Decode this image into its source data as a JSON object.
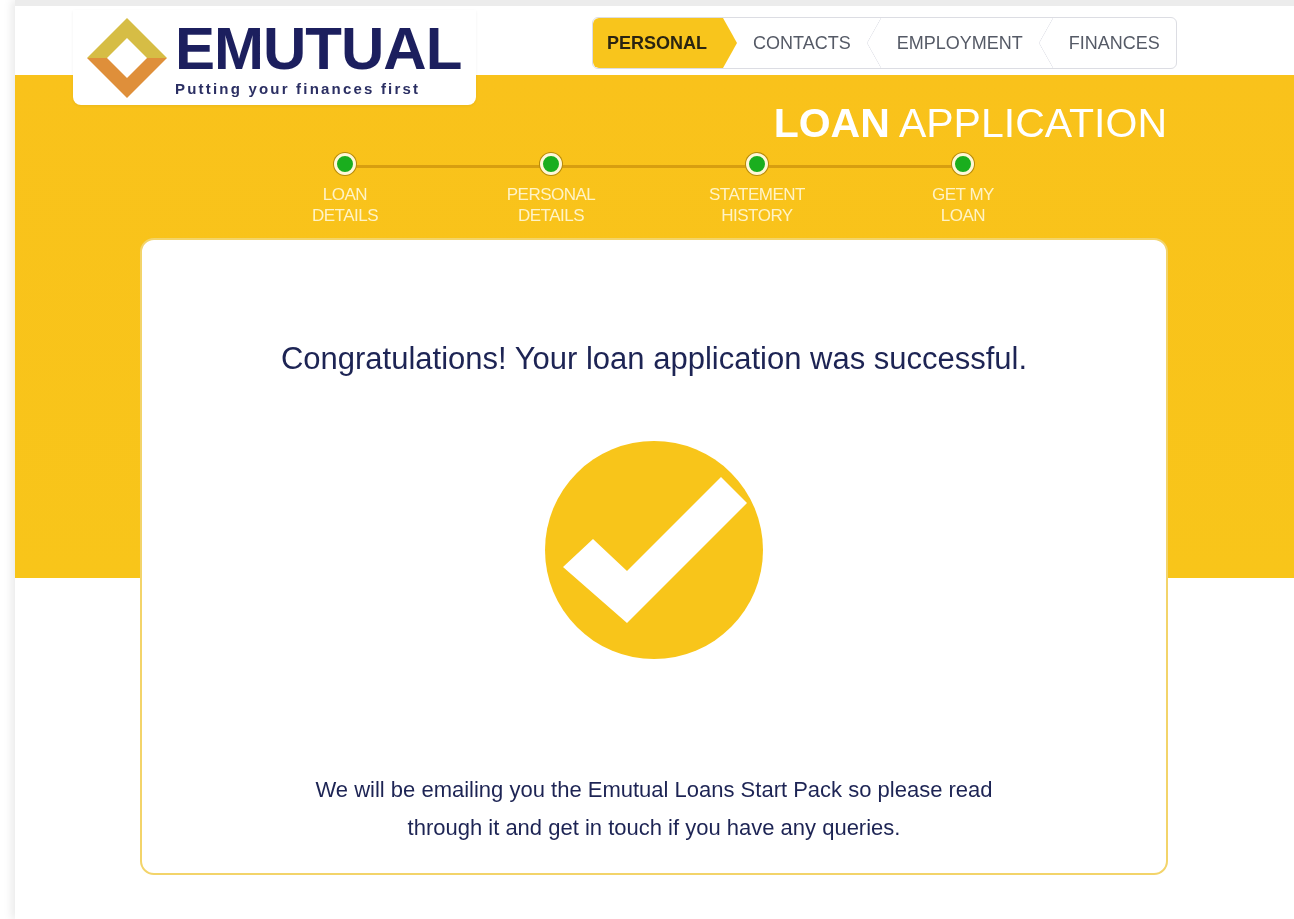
{
  "header": {
    "logo": {
      "name": "EMUTUAL",
      "tagline": "Putting your finances first"
    },
    "tabs": [
      {
        "label": "PERSONAL",
        "selected": true
      },
      {
        "label": "CONTACTS",
        "selected": false
      },
      {
        "label": "EMPLOYMENT",
        "selected": false
      },
      {
        "label": "FINANCES",
        "selected": false
      }
    ]
  },
  "banner": {
    "title": "**LOAN** APPLICATION",
    "steps": [
      {
        "label": "LOAN\nDETAILS",
        "completed": true
      },
      {
        "label": "PERSONAL\nDETAILS",
        "completed": true
      },
      {
        "label": "STATEMENT\nHISTORY",
        "completed": true
      },
      {
        "label": "GET MY\nLOAN",
        "completed": true
      }
    ]
  },
  "result": {
    "message": "Congratulations! Your loan application was successful.",
    "success": true,
    "note": "We will be emailing you the Emutual Loans Start Pack so please read through it and get in touch if you have any queries."
  }
}
